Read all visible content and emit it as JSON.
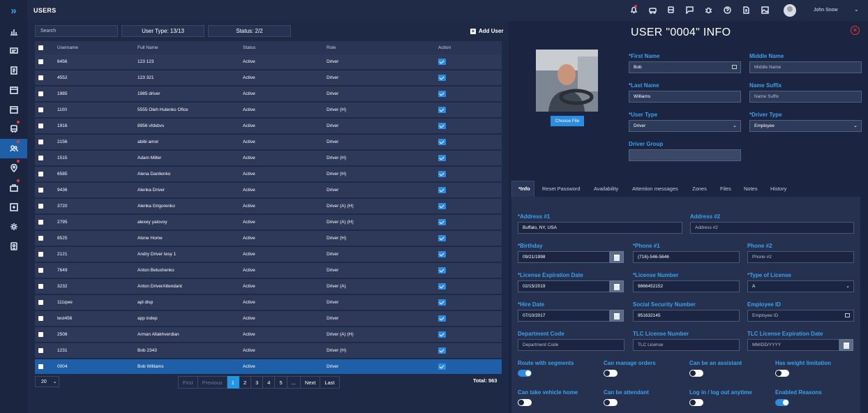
{
  "app": {
    "section": "USERS"
  },
  "header": {
    "user_name": "John Snow"
  },
  "list": {
    "search_placeholder": "Search",
    "user_type_filter": "User Type: 13/13",
    "status_filter": "Status: 2/2",
    "add_user": "Add User",
    "columns": [
      "Username",
      "Full Name",
      "Status",
      "Role",
      "Action"
    ],
    "rows": [
      {
        "username": "6456",
        "full_name": "123 123",
        "status": "Active",
        "role": "Driver"
      },
      {
        "username": "4552",
        "full_name": "123 321",
        "status": "Active",
        "role": "Driver"
      },
      {
        "username": "1985",
        "full_name": "1985 driver",
        "status": "Active",
        "role": "Driver"
      },
      {
        "username": "1100",
        "full_name": "5555 Oleh Hulenko Ofice",
        "status": "Active",
        "role": "Driver (H)"
      },
      {
        "username": "1916",
        "full_name": "8956 vfdsbvs",
        "status": "Active",
        "role": "Driver"
      },
      {
        "username": "2156",
        "full_name": "abibi amor",
        "status": "Active",
        "role": "Driver"
      },
      {
        "username": "1515",
        "full_name": "Adam Miller",
        "status": "Active",
        "role": "Driver (H)"
      },
      {
        "username": "6585",
        "full_name": "Alena Danilenko",
        "status": "Active",
        "role": "Driver (H)"
      },
      {
        "username": "9436",
        "full_name": "Alenka Driver",
        "status": "Active",
        "role": "Driver"
      },
      {
        "username": "3720",
        "full_name": "Alenka Grigorenko",
        "status": "Active",
        "role": "Driver (A) (H)"
      },
      {
        "username": "2795",
        "full_name": "alexey yalovoy",
        "status": "Active",
        "role": "Driver (A) (H)"
      },
      {
        "username": "8525",
        "full_name": "Alone Home",
        "status": "Active",
        "role": "Driver (H)"
      },
      {
        "username": "2121",
        "full_name": "Andry Driver tesy 1",
        "status": "Active",
        "role": "Driver"
      },
      {
        "username": "7649",
        "full_name": "Anton Belushenko",
        "status": "Active",
        "role": "Driver"
      },
      {
        "username": "3232",
        "full_name": "Anton DriverAttendant",
        "status": "Active",
        "role": "Driver (A)"
      },
      {
        "username": "111qwe",
        "full_name": "apl disp",
        "status": "Active",
        "role": "Driver"
      },
      {
        "username": "test456",
        "full_name": "app indep",
        "status": "Active",
        "role": "Driver"
      },
      {
        "username": "2508",
        "full_name": "Arman Allakhverdian",
        "status": "Active",
        "role": "Driver (A) (H)"
      },
      {
        "username": "1231",
        "full_name": "Bob 2343",
        "status": "Active",
        "role": "Driver (H)"
      },
      {
        "username": "0004",
        "full_name": "Bob Williams",
        "status": "Active",
        "role": "Driver"
      }
    ],
    "page_size": "20",
    "pager": [
      "First",
      "Previous",
      "1",
      "2",
      "3",
      "4",
      "5",
      "...",
      "Next",
      "Last"
    ],
    "total": "Total: 563"
  },
  "form": {
    "title": "USER \"0004\" INFO",
    "choose_file": "Choose File",
    "first_name_label": "*First Name",
    "first_name": "Bob",
    "middle_name_label": "Middle Name",
    "middle_name_ph": "Middle Name",
    "last_name_label": "*Last Name",
    "last_name": "Williams",
    "name_suffix_label": "Name Suffix",
    "name_suffix_ph": "Name Suffix",
    "user_type_label": "*User Type",
    "user_type": "Driver",
    "driver_type_label": "*Driver Type",
    "driver_type": "Employee",
    "driver_group_label": "Driver Group",
    "tabs": [
      "*Info",
      "Reset Password",
      "Availability",
      "Attention messages",
      "Zones",
      "Files",
      "Notes",
      "History"
    ],
    "address1_label": "*Address #1",
    "address1": "Buffalo, NY, USA",
    "address2_label": "Address #2",
    "address2_ph": "Address #2",
    "birthday_label": "*Birthday",
    "birthday": "09/21/1998",
    "phone1_label": "*Phone #1",
    "phone1": "(716)-546-5646",
    "phone2_label": "Phone #2",
    "phone2_ph": "Phone #2",
    "license_exp_label": "*License Expiration Date",
    "license_exp": "02/15/2019",
    "license_num_label": "*License Number",
    "license_num": "9866452152",
    "license_type_label": "*Type of License",
    "license_type": "A",
    "hire_date_label": "*Hire Date",
    "hire_date": "07/10/2017",
    "ssn_label": "Social Security Number",
    "ssn": "951632145",
    "employee_id_label": "Employee ID",
    "employee_id_ph": "Employee ID",
    "dept_code_label": "Department Code",
    "dept_code_ph": "Department Code",
    "tlc_license_label": "TLC License Number",
    "tlc_license_ph": "TLC License",
    "tlc_exp_label": "TLC License Expiration Date",
    "tlc_exp_ph": "MM/DD/YYYY",
    "toggles": [
      {
        "label": "Route with segments",
        "on": true
      },
      {
        "label": "Can manage orders",
        "on": false
      },
      {
        "label": "Can be an assistant",
        "on": false
      },
      {
        "label": "Has weight limitation",
        "on": false
      },
      {
        "label": "Can take vehicle home",
        "on": false
      },
      {
        "label": "Can be attendant",
        "on": false
      },
      {
        "label": "Log in / log out anytime",
        "on": false
      },
      {
        "label": "Enabled Reasons",
        "on": true
      }
    ]
  }
}
